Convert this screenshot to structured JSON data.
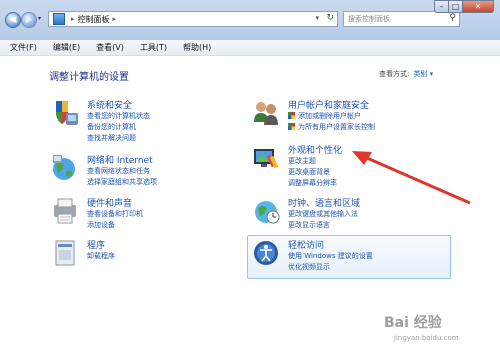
{
  "address": {
    "crumb": "控制面板",
    "separator": "▸",
    "dropdown_glyph": "▾",
    "refresh_glyph": "↻"
  },
  "search": {
    "placeholder": "搜索控制面板"
  },
  "menubar": [
    "文件(F)",
    "编辑(E)",
    "查看(V)",
    "工具(T)",
    "帮助(H)"
  ],
  "page_title": "调整计算机的设置",
  "view_by": {
    "label": "查看方式:",
    "value": "类别 ▾"
  },
  "categories": [
    {
      "title": "系统和安全",
      "links": [
        "查看您的计算机状态",
        "备份您的计算机",
        "查找并解决问题"
      ]
    },
    {
      "title": "网络和 Internet",
      "links": [
        "查看网络状态和任务",
        "选择家庭组和共享选项"
      ]
    },
    {
      "title": "硬件和声音",
      "links": [
        "查看设备和打印机",
        "添加设备"
      ]
    },
    {
      "title": "程序",
      "links": [
        "卸载程序"
      ]
    },
    {
      "title": "用户帐户和家庭安全",
      "links": [
        "添加或删除用户帐户",
        "为所有用户设置家长控制"
      ]
    },
    {
      "title": "外观和个性化",
      "links": [
        "更改主题",
        "更改桌面背景",
        "调整屏幕分辨率"
      ]
    },
    {
      "title": "时钟、语言和区域",
      "links": [
        "更改键盘或其他输入法",
        "更改显示语言"
      ]
    },
    {
      "title": "轻松访问",
      "links": [
        "使用 Windows 建议的设置",
        "优化视频显示"
      ]
    }
  ],
  "icons": {
    "nav": [
      "back-arrow-icon",
      "forward-arrow-icon"
    ],
    "accent": "#1f52b6",
    "arrow_color": "#e0362c"
  },
  "window_controls": {
    "close": "✕",
    "maximize": "□",
    "minimize": "–"
  },
  "watermark": {
    "text": "Bai 经验",
    "url": "jingyan.baidu.com"
  }
}
